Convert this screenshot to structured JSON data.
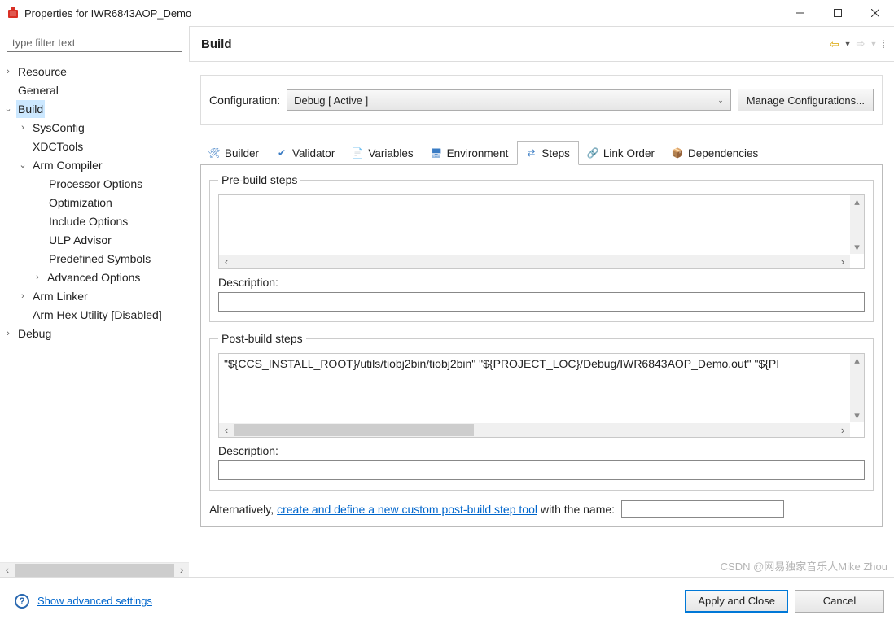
{
  "window": {
    "title": "Properties for IWR6843AOP_Demo"
  },
  "sidebar": {
    "filter_placeholder": "type filter text",
    "items": {
      "resource": "Resource",
      "general": "General",
      "build": "Build",
      "sysconfig": "SysConfig",
      "xdctools": "XDCTools",
      "arm_compiler": "Arm Compiler",
      "processor_options": "Processor Options",
      "optimization": "Optimization",
      "include_options": "Include Options",
      "ulp_advisor": "ULP Advisor",
      "predefined_symbols": "Predefined Symbols",
      "advanced_options": "Advanced Options",
      "arm_linker": "Arm Linker",
      "arm_hex_utility": "Arm Hex Utility  [Disabled]",
      "debug": "Debug"
    }
  },
  "header": {
    "title": "Build"
  },
  "config": {
    "label": "Configuration:",
    "value": "Debug  [ Active ]",
    "manage": "Manage Configurations..."
  },
  "tabs": {
    "builder": "Builder",
    "validator": "Validator",
    "variables": "Variables",
    "environment": "Environment",
    "steps": "Steps",
    "link_order": "Link Order",
    "dependencies": "Dependencies"
  },
  "steps": {
    "pre_legend": "Pre-build steps",
    "pre_desc_label": "Description:",
    "post_legend": "Post-build steps",
    "post_content": "\"${CCS_INSTALL_ROOT}/utils/tiobj2bin/tiobj2bin\" \"${PROJECT_LOC}/Debug/IWR6843AOP_Demo.out\" \"${PI",
    "post_desc_label": "Description:",
    "alt_prefix": "Alternatively, ",
    "alt_link": "create and define a new custom post-build step tool",
    "alt_suffix": " with the name:"
  },
  "footer": {
    "advanced": "Show advanced settings",
    "apply": "Apply and Close",
    "cancel": "Cancel"
  },
  "watermark": "CSDN @网易独家音乐人Mike Zhou"
}
